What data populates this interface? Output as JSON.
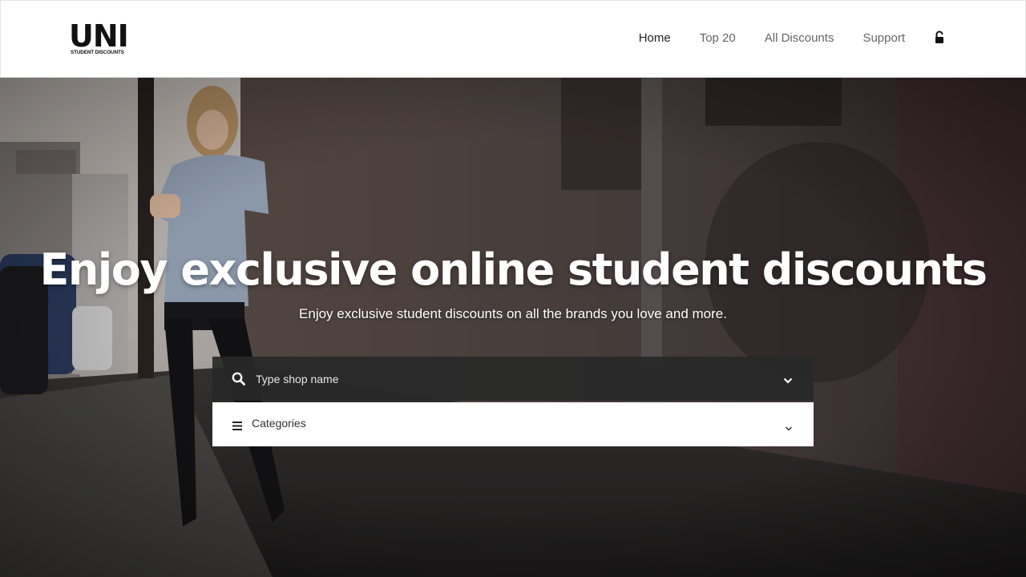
{
  "brand": {
    "name": "UNI",
    "tagline": "STUDENT DISCOUNTS"
  },
  "nav": {
    "items": [
      {
        "label": "Home",
        "active": true
      },
      {
        "label": "Top 20",
        "active": false
      },
      {
        "label": "All Discounts",
        "active": false
      },
      {
        "label": "Support",
        "active": false
      }
    ],
    "account_icon": "unlock-icon"
  },
  "hero": {
    "title": "Enjoy exclusive online student discounts",
    "subtitle": "Enjoy exclusive student discounts on all the brands you love and more."
  },
  "search": {
    "placeholder": "Type shop name",
    "value": "",
    "icon": "search-icon"
  },
  "categories": {
    "label": "Categories",
    "icon": "menu-icon"
  },
  "colors": {
    "search_bg": "#282828",
    "text_light": "#ffffff",
    "nav_active": "#222222",
    "nav_inactive": "#666666"
  }
}
